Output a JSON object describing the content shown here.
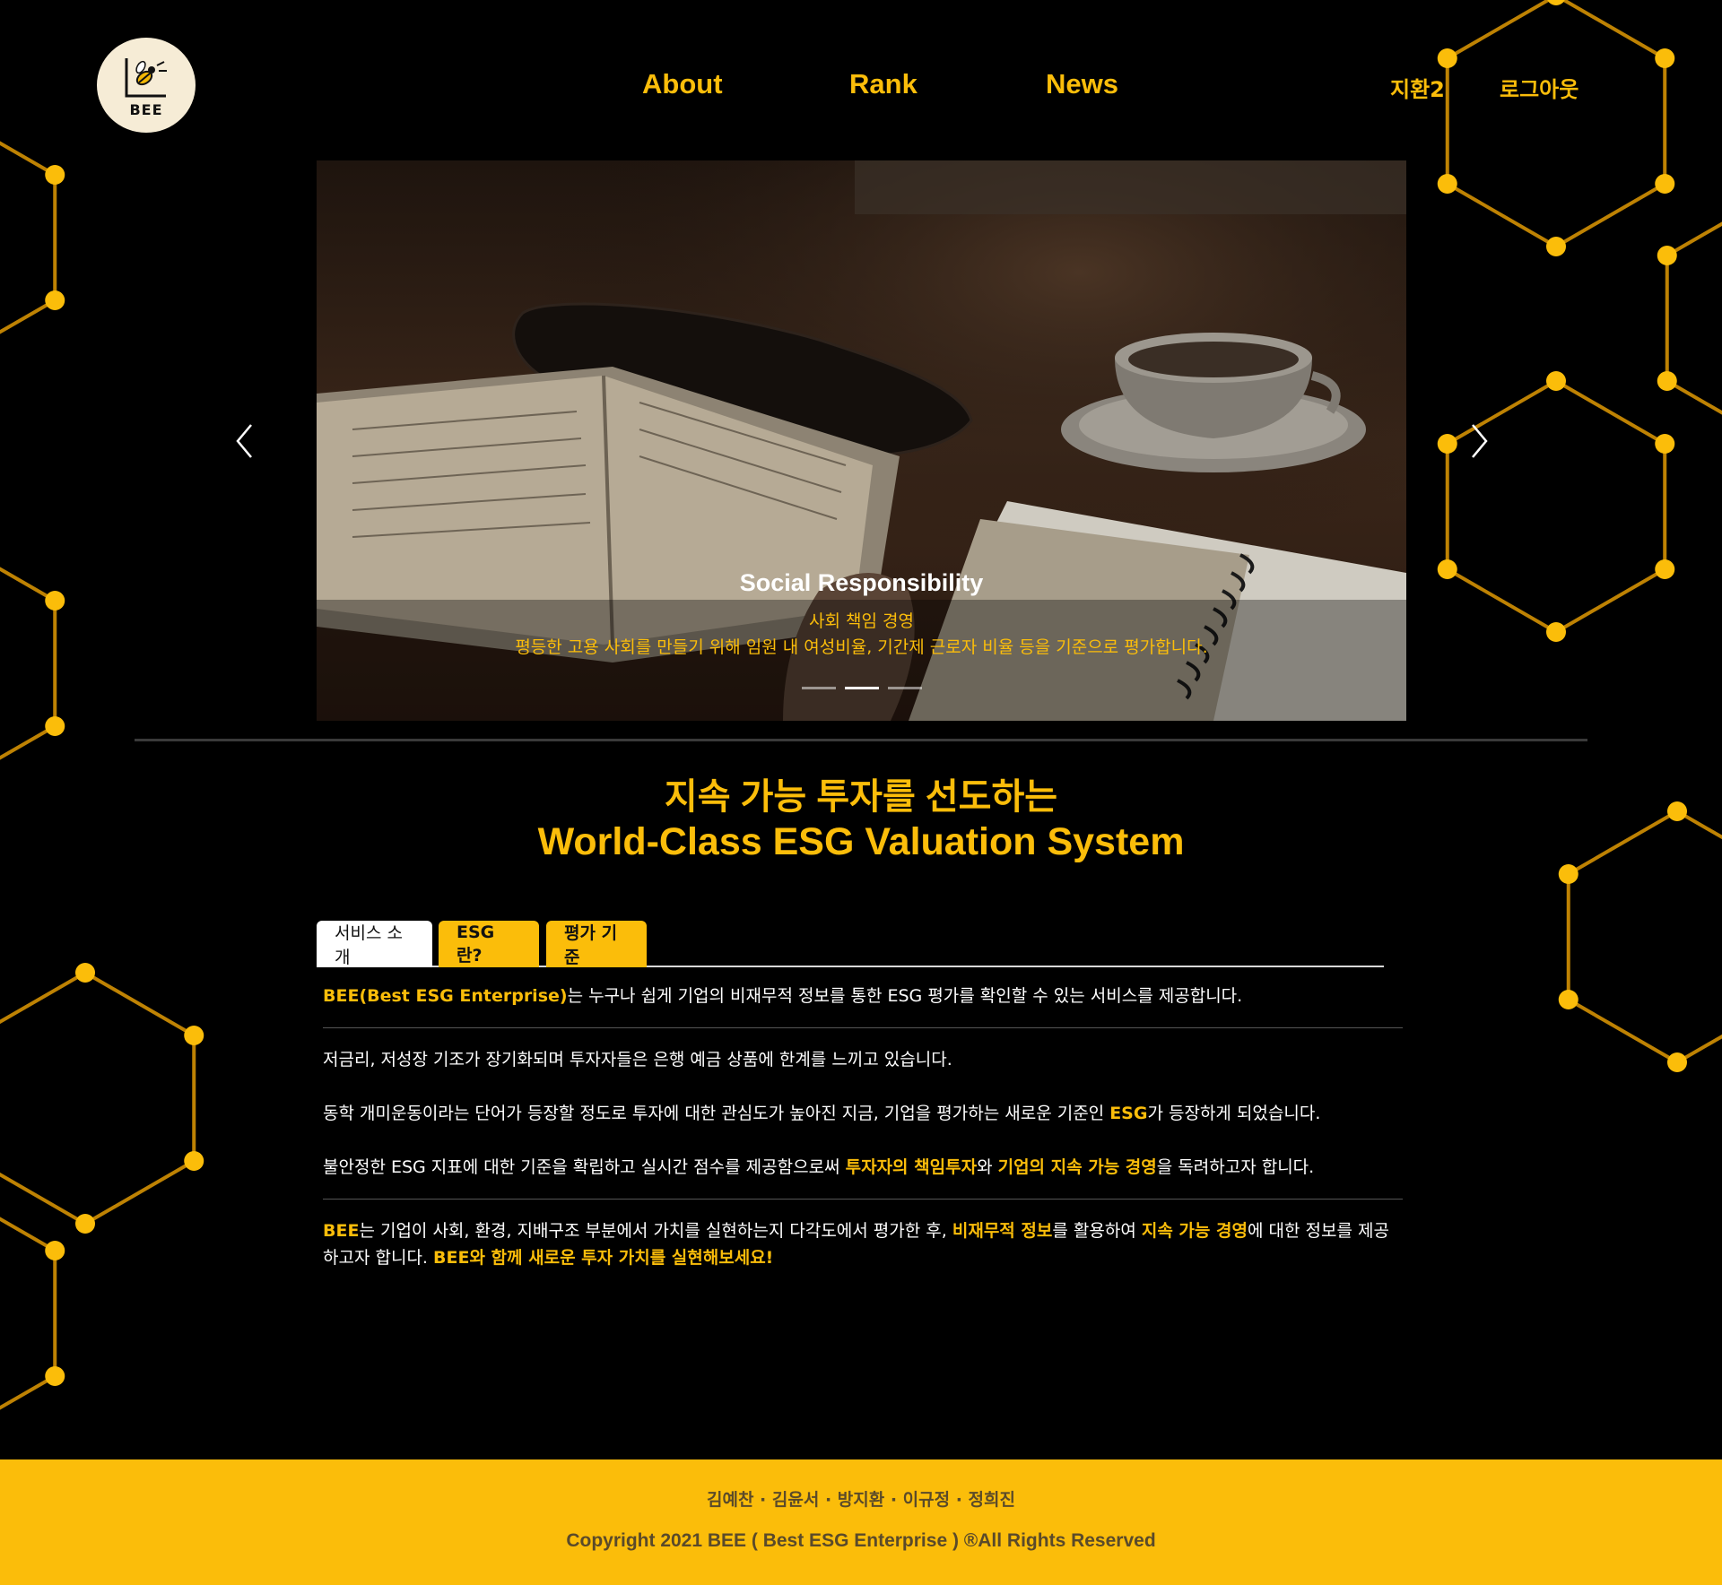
{
  "colors": {
    "accent": "#fbbd0a",
    "background": "#000000",
    "footer_text": "#5a4a2a"
  },
  "header": {
    "logo_text": "BEE",
    "nav": [
      {
        "label": "About"
      },
      {
        "label": "Rank"
      },
      {
        "label": "News"
      }
    ],
    "user_name": "지환2",
    "logout_label": "로그아웃"
  },
  "carousel": {
    "slide_title": "Social Responsibility",
    "slide_subtitle": "사회 책임 경영",
    "slide_description": "평등한 고용 사회를 만들기 위해 임원 내 여성비율, 기간제 근로자 비율 등을 기준으로 평가합니다.",
    "slide_count": 3,
    "active_slide": 2,
    "prev_icon": "chevron-left-icon",
    "next_icon": "chevron-right-icon"
  },
  "headline": {
    "line1": "지속 가능 투자를 선도하는",
    "line2": "World-Class ESG Valuation System"
  },
  "tabs": [
    {
      "label": "서비스 소개",
      "active": true
    },
    {
      "label": "ESG 란?",
      "active": false
    },
    {
      "label": "평가 기준",
      "active": false
    }
  ],
  "content": {
    "p1_hl": "BEE(Best ESG Enterprise)",
    "p1_rest": "는 누구나 쉽게 기업의 비재무적 정보를 통한 ESG 평가를 확인할 수 있는 서비스를 제공합니다.",
    "p2": "저금리, 저성장 기조가 장기화되며 투자자들은 은행 예금 상품에 한계를 느끼고 있습니다.",
    "p3_a": "동학 개미운동이라는 단어가 등장할 정도로 투자에 대한 관심도가 높아진 지금, 기업을 평가하는 새로운 기준인 ",
    "p3_hl": "ESG",
    "p3_b": "가 등장하게 되었습니다.",
    "p4_a": "불안정한 ESG 지표에 대한 기준을 확립하고 실시간 점수를 제공함으로써 ",
    "p4_hl1": "투자자의 책임투자",
    "p4_b": "와 ",
    "p4_hl2": "기업의 지속 가능 경영",
    "p4_c": "을 독려하고자 합니다.",
    "p5_hl1": "BEE",
    "p5_a": "는 기업이 사회, 환경, 지배구조 부분에서 가치를 실현하는지 다각도에서 평가한 후, ",
    "p5_hl2": "비재무적 정보",
    "p5_b": "를 활용하여 ",
    "p5_hl3": "지속 가능 경영",
    "p5_c": "에 대한 정보를 제공하고자 합니다. ",
    "p5_hl4": "BEE와 함께 새로운 투자 가치를 실현해보세요!"
  },
  "footer": {
    "names": "김예찬 · 김윤서 · 방지환 · 이규정 · 정희진",
    "copyright": "Copyright 2021 BEE ( Best ESG Enterprise ) ®All Rights Reserved"
  }
}
